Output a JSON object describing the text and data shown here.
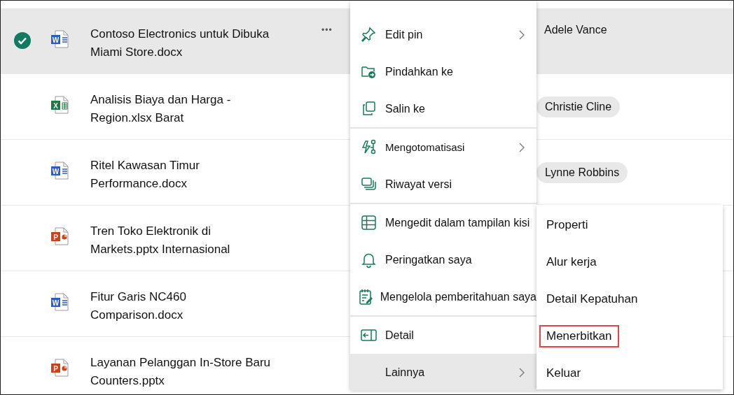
{
  "files": [
    {
      "kind": "word",
      "badge": "W",
      "selected": true,
      "line_1": "Contoso Electronics untuk Dibuka",
      "line_2": "Miami Store.docx",
      "more": "•••",
      "person": {
        "name": "Adele Vance",
        "kind": "text"
      }
    },
    {
      "kind": "excel",
      "badge": "X",
      "selected": false,
      "line_1": "Analisis Biaya dan Harga -",
      "line_2": "Region.xlsx Barat",
      "person": {
        "name": "Christie Cline",
        "kind": "chip"
      }
    },
    {
      "kind": "word",
      "badge": "W",
      "selected": false,
      "line_1": "Ritel Kawasan Timur",
      "line_2": "Performance.docx",
      "person": {
        "name": "Lynne Robbins",
        "kind": "chip"
      }
    },
    {
      "kind": "powerpoint",
      "badge": "P",
      "selected": false,
      "line_1": "Tren Toko Elektronik di",
      "line_2": "Markets.pptx Internasional"
    },
    {
      "kind": "word",
      "badge": "W",
      "selected": false,
      "line_1": "Fitur Garis NC460",
      "line_2": "Comparison.docx"
    },
    {
      "kind": "powerpoint",
      "badge": "P",
      "selected": false,
      "line_1": "Layanan Pelanggan In-Store Baru",
      "line_2": "Counters.pptx"
    }
  ],
  "context_menu": {
    "groups": [
      [
        {
          "label": "Edit pin",
          "submenu": true,
          "selected": false
        },
        {
          "label": "Pindahkan ke",
          "submenu": false,
          "selected": false
        },
        {
          "label": "Salin ke",
          "submenu": false,
          "selected": false
        }
      ],
      [
        {
          "label": "Mengotomatisasi",
          "submenu": true,
          "selected": false
        },
        {
          "label": "Riwayat versi",
          "submenu": false,
          "selected": false
        }
      ],
      [
        {
          "label": "Mengedit dalam tampilan kisi",
          "submenu": false,
          "selected": false
        },
        {
          "label": "Peringatkan saya",
          "submenu": false,
          "selected": false
        },
        {
          "label": "Mengelola pemberitahuan saya",
          "submenu": false,
          "selected": false
        }
      ],
      [
        {
          "label": "Detail",
          "submenu": false,
          "selected": false
        },
        {
          "label": "Lainnya",
          "submenu": true,
          "selected": true
        }
      ]
    ]
  },
  "submenu": {
    "items": [
      {
        "label": "Properti",
        "outlined": false
      },
      {
        "label": "Alur kerja",
        "outlined": false
      },
      {
        "label": "Detail Kepatuhan",
        "outlined": false
      },
      {
        "label": "Menerbitkan",
        "outlined": true
      },
      {
        "label": "Keluar",
        "outlined": false
      }
    ]
  }
}
